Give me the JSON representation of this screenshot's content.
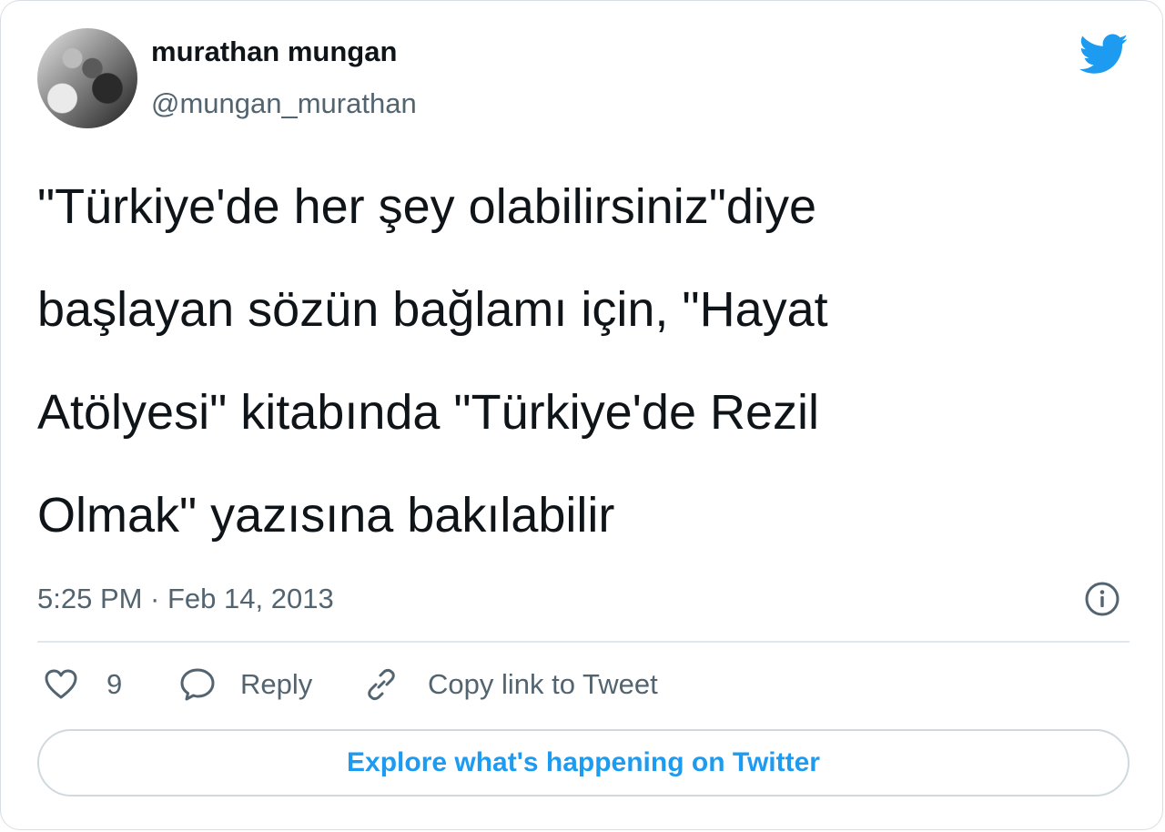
{
  "author": {
    "display_name": "murathan mungan",
    "handle": "@mungan_murathan"
  },
  "tweet": {
    "lines": [
      "\"Türkiye'de her şey olabilirsiniz\"diye",
      "başlayan sözün bağlamı için, \"Hayat",
      "Atölyesi\" kitabında \"Türkiye'de Rezil",
      "Olmak\" yazısına bakılabilir"
    ],
    "timestamp": "5:25 PM · Feb 14, 2013"
  },
  "actions": {
    "like_count": "9",
    "reply_label": "Reply",
    "copy_link_label": "Copy link to Tweet"
  },
  "cta": {
    "explore_label": "Explore what's happening on Twitter"
  },
  "colors": {
    "accent": "#1d9bf0",
    "text": "#0f1419",
    "secondary": "#536471",
    "border": "#cfd9de"
  },
  "icons": [
    "twitter-bird-icon",
    "info-icon",
    "heart-icon",
    "reply-bubble-icon",
    "link-icon"
  ]
}
